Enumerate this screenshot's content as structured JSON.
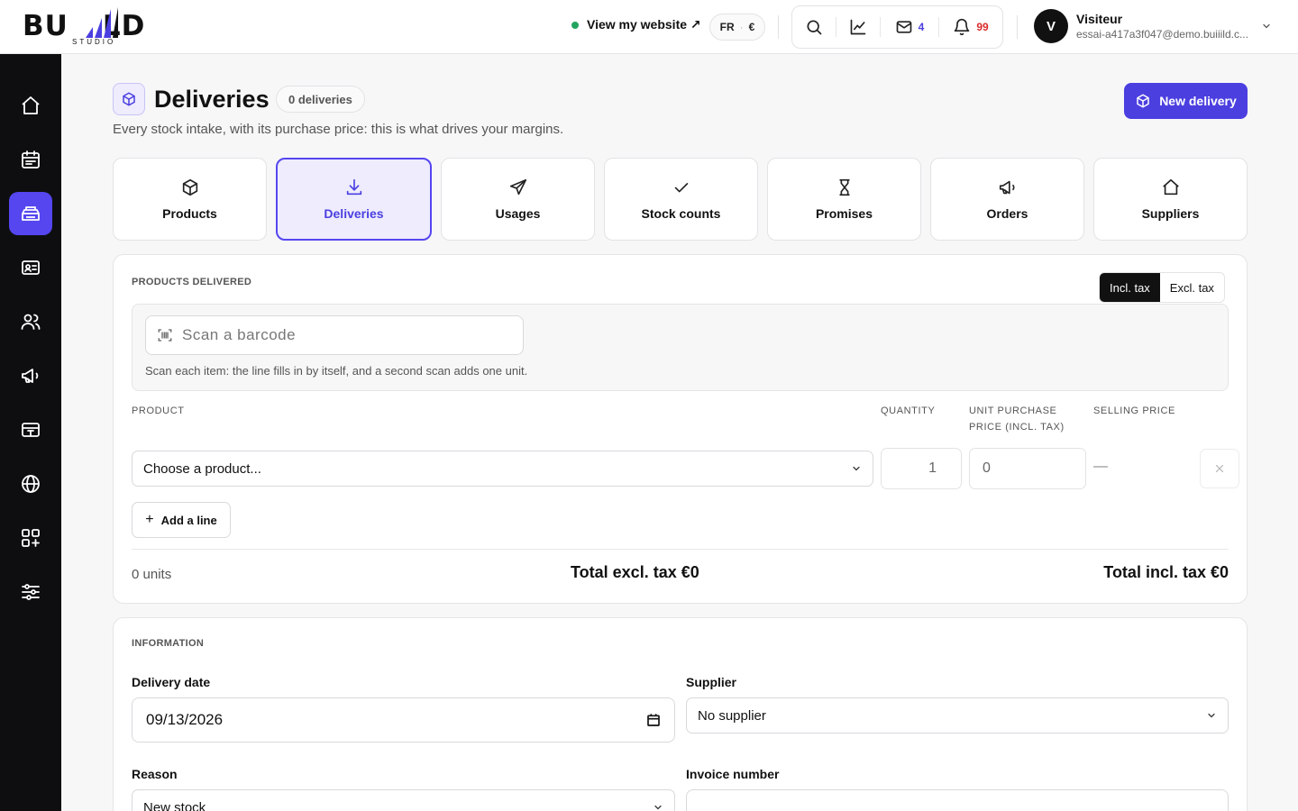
{
  "brand": {
    "logo_text": "BUILD",
    "logo_sub": "STUDIO"
  },
  "header": {
    "view_site_label": "View my website ↗",
    "lang": "FR",
    "currency": "€",
    "mail_count": "4",
    "notif_count": "99",
    "user_initial": "V",
    "user_name": "Visiteur",
    "user_email": "essai-a417a3f047@demo.buiiild.c..."
  },
  "sidebar": {
    "items": [
      {
        "icon": "home-icon"
      },
      {
        "icon": "calendar-icon"
      },
      {
        "icon": "inventory-icon",
        "active": true
      },
      {
        "icon": "id-card-icon"
      },
      {
        "icon": "users-icon"
      },
      {
        "icon": "megaphone-icon"
      },
      {
        "icon": "payment-terminal-icon"
      },
      {
        "icon": "globe-icon"
      },
      {
        "icon": "apps-icon"
      },
      {
        "icon": "sliders-icon"
      }
    ]
  },
  "page": {
    "title": "Deliveries",
    "count": "0 deliveries",
    "subtitle": "Every stock intake, with its purchase price: this is what drives your margins.",
    "new_button": "New delivery"
  },
  "tabs": [
    {
      "label": "Products",
      "icon": "box-icon"
    },
    {
      "label": "Deliveries",
      "icon": "download-icon",
      "active": true
    },
    {
      "label": "Usages",
      "icon": "send-icon"
    },
    {
      "label": "Stock counts",
      "icon": "check-icon"
    },
    {
      "label": "Promises",
      "icon": "hourglass-icon"
    },
    {
      "label": "Orders",
      "icon": "megaphone-icon"
    },
    {
      "label": "Suppliers",
      "icon": "house-icon"
    }
  ],
  "products": {
    "section_label": "PRODUCTS DELIVERED",
    "tax_toggle": {
      "incl": "Incl. tax",
      "excl": "Excl. tax",
      "selected": "incl"
    },
    "scan_placeholder": "Scan a barcode",
    "scan_help": "Scan each item: the line fills in by itself, and a second scan adds one unit.",
    "columns": {
      "product": "PRODUCT",
      "quantity": "QUANTITY",
      "unit_price_1": "UNIT PURCHASE",
      "unit_price_2": "PRICE (INCL. TAX)",
      "selling_price": "SELLING PRICE"
    },
    "line": {
      "product_placeholder": "Choose a product...",
      "quantity": "1",
      "unit_price": "0",
      "selling_price": "—"
    },
    "add_line": "Add a line",
    "units": "0 units",
    "total_excl": "Total excl. tax €0",
    "total_incl": "Total incl. tax €0"
  },
  "information": {
    "section_label": "INFORMATION",
    "delivery_date_label": "Delivery date",
    "delivery_date_value": "09/13/2026",
    "supplier_label": "Supplier",
    "supplier_value": "No supplier",
    "reason_label": "Reason",
    "reason_value": "New stock",
    "invoice_label": "Invoice number",
    "invoice_value": ""
  }
}
